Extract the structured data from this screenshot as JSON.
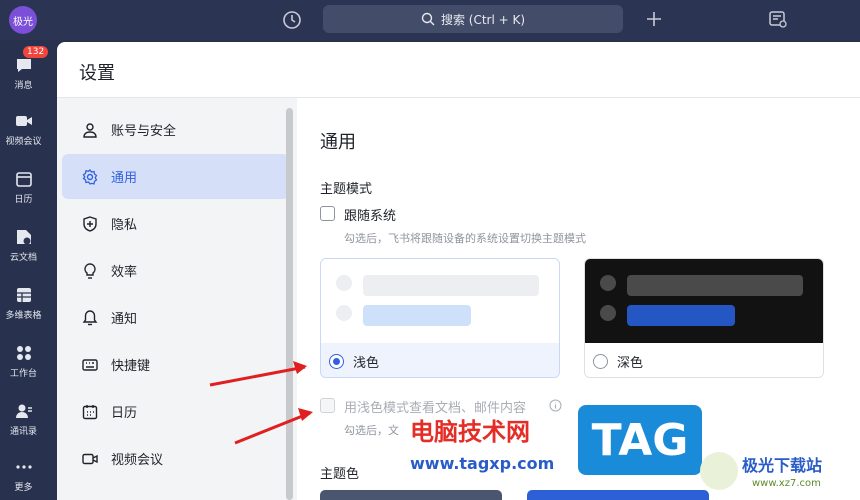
{
  "app": {
    "avatar_label": "极光"
  },
  "topbar": {
    "search_label": "搜索 (Ctrl + K)"
  },
  "rail": {
    "badge": "132",
    "items": [
      {
        "label": "消息"
      },
      {
        "label": "视频会议"
      },
      {
        "label": "日历"
      },
      {
        "label": "云文档"
      },
      {
        "label": "多维表格"
      },
      {
        "label": "工作台"
      },
      {
        "label": "通讯录"
      },
      {
        "label": "更多"
      }
    ]
  },
  "settings": {
    "title": "设置",
    "nav": [
      {
        "label": "账号与安全"
      },
      {
        "label": "通用"
      },
      {
        "label": "隐私"
      },
      {
        "label": "效率"
      },
      {
        "label": "通知"
      },
      {
        "label": "快捷键"
      },
      {
        "label": "日历"
      },
      {
        "label": "视频会议"
      }
    ],
    "active_nav": "通用"
  },
  "general": {
    "heading": "通用",
    "theme_mode_label": "主题模式",
    "follow_system_label": "跟随系统",
    "follow_system_hint": "勾选后，飞书将跟随设备的系统设置切换主题模式",
    "light_label": "浅色",
    "dark_label": "深色",
    "selected_theme": "浅色",
    "light_doc_label": "用浅色模式查看文档、邮件内容",
    "light_doc_hint": "勾选后，文",
    "theme_color_label": "主题色"
  },
  "watermark": {
    "site_title": "电脑技术网",
    "site_url": "www.tagxp.com",
    "logo_text": "TAG",
    "brand_cn": "极光下载站",
    "brand_url": "www.xz7.com"
  },
  "colors": {
    "accent": "#3261e0",
    "topbar": "#2b3553",
    "badge": "#f0453d",
    "arrow": "#e02020"
  }
}
